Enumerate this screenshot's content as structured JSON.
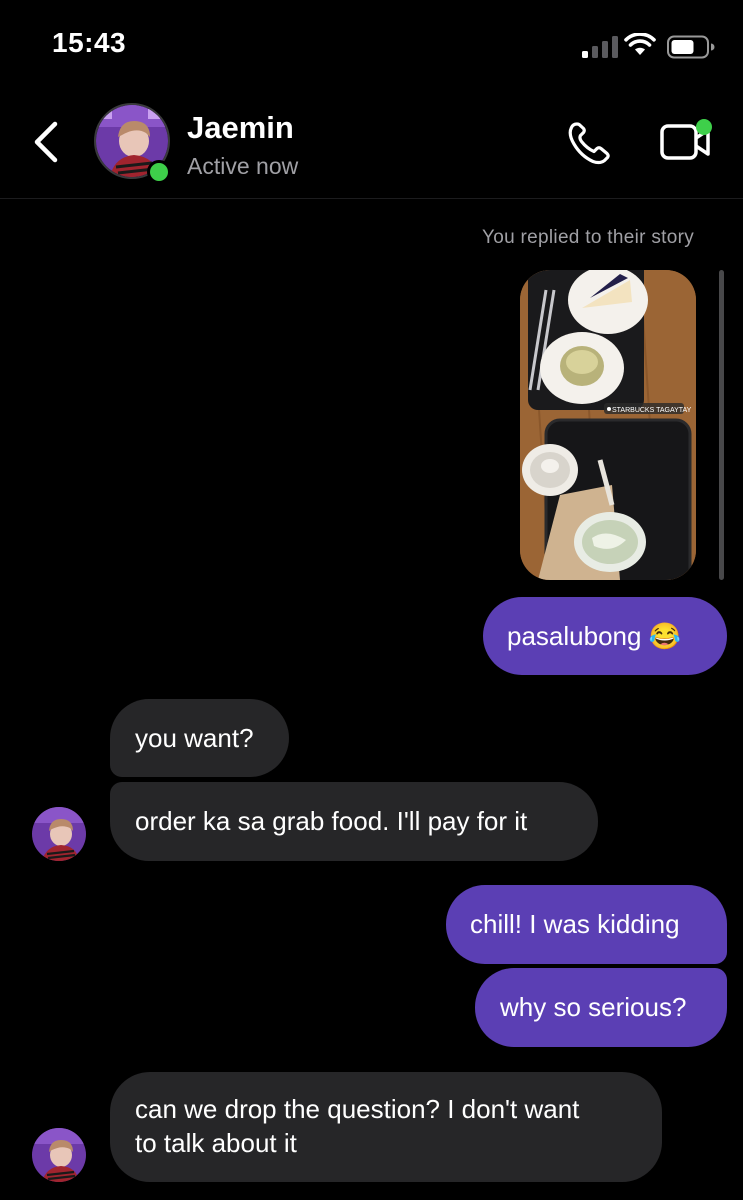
{
  "status_bar": {
    "time": "15:43"
  },
  "header": {
    "contact_name": "Jaemin",
    "contact_status": "Active now",
    "icons": {
      "back": "chevron-left-icon",
      "call": "phone-icon",
      "video": "video-camera-icon"
    }
  },
  "messages": {
    "story_caption": "You replied to their story",
    "story_location_sticker": "STARBUCKS TAGAYTAY",
    "items": [
      {
        "side": "sent",
        "text": "pasalubong 😂"
      },
      {
        "side": "received",
        "text": "you want?"
      },
      {
        "side": "received",
        "text": "order ka sa grab food. I'll pay for it"
      },
      {
        "side": "sent",
        "text": "chill! I was kidding"
      },
      {
        "side": "sent",
        "text": "why so serious?"
      },
      {
        "side": "received",
        "line1": "can we drop the question? I don't want",
        "line2": "to talk about it"
      }
    ]
  },
  "colors": {
    "background": "#000000",
    "sent_bubble": "#5b3fb4",
    "received_bubble": "#262628",
    "active_indicator": "#3ecf4a",
    "notification_dot": "#3ecf4a",
    "secondary_text": "#a0a0a5"
  }
}
